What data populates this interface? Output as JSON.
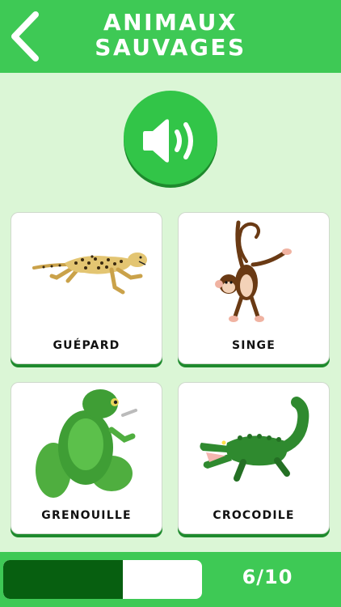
{
  "header": {
    "title_line1": "ANIMAUX",
    "title_line2": "SAUVAGES",
    "back_icon": "chevron-left-icon"
  },
  "sound_button": {
    "icon": "speaker-icon"
  },
  "cards": [
    {
      "label": "GUÉPARD",
      "icon": "cheetah"
    },
    {
      "label": "SINGE",
      "icon": "monkey"
    },
    {
      "label": "GRENOUILLE",
      "icon": "frog"
    },
    {
      "label": "CROCODILE",
      "icon": "crocodile"
    }
  ],
  "progress": {
    "current": 6,
    "total": 10,
    "text": "6/10",
    "fraction": 0.6
  },
  "colors": {
    "header_green": "#3ec955",
    "background": "#dbf6d6",
    "dark_green": "#075f10"
  }
}
